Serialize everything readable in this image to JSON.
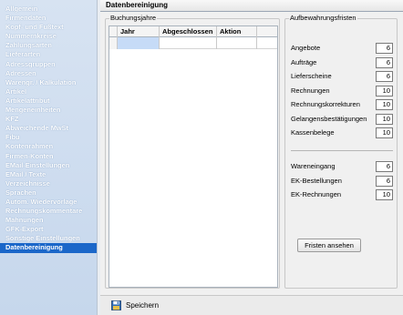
{
  "sidebar": {
    "items": [
      {
        "label": "Allgemein"
      },
      {
        "label": "Firmendaten"
      },
      {
        "label": "Kopf- und Fußtext"
      },
      {
        "label": "Nummernkreise"
      },
      {
        "label": "Zahlungsarten"
      },
      {
        "label": "Lieferarten"
      },
      {
        "label": "Adressgruppen"
      },
      {
        "label": "Adressen"
      },
      {
        "label": "Warengr. / Kalkulation"
      },
      {
        "label": "Artikel"
      },
      {
        "label": "Artikelattribut"
      },
      {
        "label": "Mengeneinheiten"
      },
      {
        "label": "KFZ"
      },
      {
        "label": "Abweichende MwSt"
      },
      {
        "label": "Fibu"
      },
      {
        "label": "Kontenrahmen"
      },
      {
        "label": "Firmen-Konten"
      },
      {
        "label": "EMail-Einstellungen"
      },
      {
        "label": "EMail / Texte"
      },
      {
        "label": "Verzeichnisse"
      },
      {
        "label": "Sprachen"
      },
      {
        "label": "Autom. Wiedervorlage"
      },
      {
        "label": "Rechnungskommentare"
      },
      {
        "label": "Mahnungen"
      },
      {
        "label": "GFK-Export"
      },
      {
        "label": "Sonstige Einstellungen"
      },
      {
        "label": "Datenbereinigung",
        "selected": true
      }
    ]
  },
  "header": {
    "title": "Datenbereinigung"
  },
  "years_group": {
    "title": "Buchungsjahre",
    "columns": [
      "",
      "Jahr",
      "Abgeschlossen",
      "Aktion"
    ]
  },
  "retention_group": {
    "title": "Aufbewahrungsfristen",
    "items": [
      {
        "label": "Angebote",
        "value": "6"
      },
      {
        "label": "Aufträge",
        "value": "6"
      },
      {
        "label": "Lieferscheine",
        "value": "6"
      },
      {
        "label": "Rechnungen",
        "value": "10"
      },
      {
        "label": "Rechnungskorrekturen",
        "value": "10"
      },
      {
        "label": "Gelangensbestätigungen",
        "value": "10"
      },
      {
        "label": "Kassenbelege",
        "value": "10"
      }
    ],
    "items2": [
      {
        "label": "Wareneingang",
        "value": "6"
      },
      {
        "label": "EK-Bestellungen",
        "value": "6"
      },
      {
        "label": "EK-Rechnungen",
        "value": "10"
      }
    ],
    "button_label": "Fristen ansehen"
  },
  "toolbar": {
    "save_label": "Speichern"
  },
  "colors": {
    "selected": "#1b67c9",
    "sidebar_bg": "#cddcef",
    "grid_selection": "#c6dbf7"
  }
}
